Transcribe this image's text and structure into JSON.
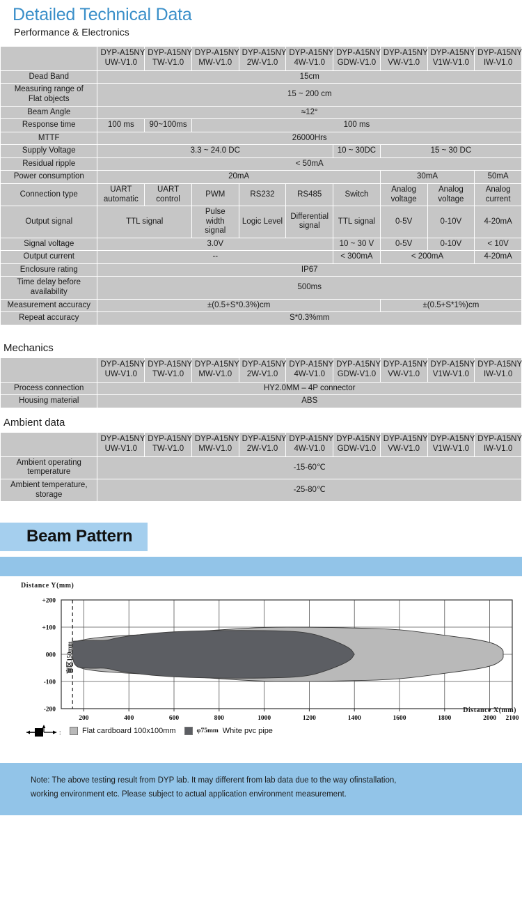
{
  "header": {
    "title": "Detailed Technical Data",
    "subtitle": "Performance & Electronics"
  },
  "colors": {
    "title_blue": "#3a8fc9",
    "header_blue": "#93c5e8",
    "banner_blue": "#92c4e8",
    "row_label_gray": "#a8a8a8",
    "cell_gray": "#c6c6c6",
    "beam_pipe_dark": "#5c5e63",
    "beam_card_light": "#b9b9b9"
  },
  "models": [
    "DYP-A15NY UW-V1.0",
    "DYP-A15NY TW-V1.0",
    "DYP-A15NY MW-V1.0",
    "DYP-A15NY 2W-V1.0",
    "DYP-A15NY 4W-V1.0",
    "DYP-A15NY GDW-V1.0",
    "DYP-A15NY VW-V1.0",
    "DYP-A15NY V1W-V1.0",
    "DYP-A15NY IW-V1.0"
  ],
  "model_lines": [
    [
      "DYP-A15NY",
      "UW-V1.0"
    ],
    [
      "DYP-A15NY",
      "TW-V1.0"
    ],
    [
      "DYP-A15NY",
      "MW-V1.0"
    ],
    [
      "DYP-A15NY",
      "2W-V1.0"
    ],
    [
      "DYP-A15NY",
      "4W-V1.0"
    ],
    [
      "DYP-A15NY",
      "GDW-V1.0"
    ],
    [
      "DYP-A15NY",
      "VW-V1.0"
    ],
    [
      "DYP-A15NY",
      "V1W-V1.0"
    ],
    [
      "DYP-A15NY",
      "IW-V1.0"
    ]
  ],
  "performance": {
    "rows": [
      {
        "label": "Dead Band",
        "cells": [
          {
            "text": "15cm",
            "span": 9
          }
        ]
      },
      {
        "label": "Measuring range of Flat objects",
        "label_lines": [
          "Measuring range of",
          "Flat objects"
        ],
        "cells": [
          {
            "text": "15 ~ 200 cm",
            "span": 9
          }
        ]
      },
      {
        "label": "Beam Angle",
        "cells": [
          {
            "text": "≈12°",
            "span": 9
          }
        ]
      },
      {
        "label": "Response time",
        "cells": [
          {
            "text": "100 ms",
            "span": 1
          },
          {
            "text": "90~100ms",
            "span": 1
          },
          {
            "text": "100 ms",
            "span": 7
          }
        ]
      },
      {
        "label": "MTTF",
        "cells": [
          {
            "text": "26000Hrs",
            "span": 9
          }
        ]
      },
      {
        "label": "Supply Voltage",
        "cells": [
          {
            "text": "3.3 ~ 24.0 DC",
            "span": 5
          },
          {
            "text": "10 ~ 30DC",
            "span": 1
          },
          {
            "text": "15 ~ 30 DC",
            "span": 3
          }
        ]
      },
      {
        "label": "Residual ripple",
        "cells": [
          {
            "text": "< 50mA",
            "span": 9
          }
        ]
      },
      {
        "label": "Power consumption",
        "cells": [
          {
            "text": "20mA",
            "span": 6
          },
          {
            "text": "30mA",
            "span": 2
          },
          {
            "text": "50mA",
            "span": 1
          }
        ]
      },
      {
        "label": "Connection type",
        "cells": [
          {
            "text": "UART automatic",
            "lines": [
              "UART",
              "automatic"
            ],
            "span": 1
          },
          {
            "text": "UART control",
            "lines": [
              "UART",
              "control"
            ],
            "span": 1
          },
          {
            "text": "PWM",
            "span": 1
          },
          {
            "text": "RS232",
            "span": 1
          },
          {
            "text": "RS485",
            "span": 1
          },
          {
            "text": "Switch",
            "span": 1
          },
          {
            "text": "Analog voltage",
            "lines": [
              "Analog",
              "voltage"
            ],
            "span": 1
          },
          {
            "text": "Analog voltage",
            "lines": [
              "Analog",
              "voltage"
            ],
            "span": 1
          },
          {
            "text": "Analog current",
            "lines": [
              "Analog",
              "current"
            ],
            "span": 1
          }
        ]
      },
      {
        "label": "Output signal",
        "cells": [
          {
            "text": "TTL signal",
            "span": 2
          },
          {
            "text": "Pulse width signal",
            "lines": [
              "Pulse width",
              "signal"
            ],
            "span": 1
          },
          {
            "text": "Logic Level",
            "span": 1
          },
          {
            "text": "Differential signal",
            "lines": [
              "Differential",
              "signal"
            ],
            "span": 1
          },
          {
            "text": "TTL signal",
            "span": 1
          },
          {
            "text": "0-5V",
            "span": 1
          },
          {
            "text": "0-10V",
            "span": 1
          },
          {
            "text": "4-20mA",
            "span": 1
          }
        ]
      },
      {
        "label": "Signal voltage",
        "cells": [
          {
            "text": "3.0V",
            "span": 5
          },
          {
            "text": "10 ~ 30 V",
            "span": 1
          },
          {
            "text": "0-5V",
            "span": 1
          },
          {
            "text": "0-10V",
            "span": 1
          },
          {
            "text": "< 10V",
            "span": 1
          }
        ]
      },
      {
        "label": "Output current",
        "cells": [
          {
            "text": "--",
            "span": 5
          },
          {
            "text": "< 300mA",
            "span": 1
          },
          {
            "text": "< 200mA",
            "span": 2
          },
          {
            "text": "4-20mA",
            "span": 1
          }
        ]
      },
      {
        "label": "Enclosure rating",
        "cells": [
          {
            "text": "IP67",
            "span": 9
          }
        ]
      },
      {
        "label": "Time delay before availability",
        "label_lines": [
          "Time delay before",
          "availability"
        ],
        "cells": [
          {
            "text": "500ms",
            "span": 9
          }
        ]
      },
      {
        "label": "Measurement accuracy",
        "cells": [
          {
            "text": "±(0.5+S*0.3%)cm",
            "span": 6
          },
          {
            "text": "±(0.5+S*1%)cm",
            "span": 3
          }
        ]
      },
      {
        "label": "Repeat accuracy",
        "cells": [
          {
            "text": "S*0.3%mm",
            "span": 9
          }
        ]
      }
    ]
  },
  "mechanics": {
    "title": "Mechanics",
    "rows": [
      {
        "label": "Process connection",
        "cells": [
          {
            "text": "HY2.0MM – 4P connector",
            "span": 9
          }
        ]
      },
      {
        "label": "Housing material",
        "cells": [
          {
            "text": "ABS",
            "span": 9
          }
        ]
      }
    ]
  },
  "ambient": {
    "title": "Ambient data",
    "rows": [
      {
        "label": "Ambient operating temperature",
        "label_lines": [
          "Ambient operating",
          "temperature"
        ],
        "cells": [
          {
            "text": "-15-60℃",
            "span": 9
          }
        ]
      },
      {
        "label": "Ambient temperature, storage",
        "label_lines": [
          "Ambient temperature,",
          "storage"
        ],
        "cells": [
          {
            "text": "-25-80℃",
            "span": 9
          }
        ]
      }
    ]
  },
  "beam": {
    "heading": "Beam Pattern",
    "note": "Note: The above testing result from DYP lab.  It may different from lab data due to the way ofinstallation, working environment etc. Please subject to actual application environment measurement.",
    "note_lines": [
      "Note: The above testing result from DYP lab.  It may different from lab data due to the way ofinstallation,",
      "working environment etc. Please subject to actual application environment measurement."
    ],
    "blind_zone_label": "盲区150mm",
    "legend": [
      {
        "swatch": "card",
        "label": "Flat cardboard 100x100mm",
        "phi": ""
      },
      {
        "swatch": "pipe",
        "label": "White pvc pipe",
        "phi": "φ75mm"
      }
    ]
  },
  "chart_data": {
    "type": "area",
    "title": "Beam Pattern",
    "xlabel": "Distance X(mm)",
    "ylabel": "Distance Y(mm)",
    "xlim": [
      100,
      2100
    ],
    "ylim": [
      -200,
      200
    ],
    "xticks": [
      200,
      400,
      600,
      800,
      1000,
      1200,
      1400,
      1600,
      1800,
      2000,
      2100
    ],
    "yticks": [
      200,
      100,
      0,
      -100,
      -200
    ],
    "ytick_labels": [
      "+200",
      "+100",
      "000",
      "-100",
      "-200"
    ],
    "grid": true,
    "legend_position": "bottom-left",
    "annotations": [
      {
        "text": "盲区150mm",
        "x": 150,
        "style": "vertical-dashed-line"
      }
    ],
    "series": [
      {
        "name": "Flat cardboard 100x100mm",
        "color": "#b9b9b9",
        "upper": [
          {
            "x": 150,
            "y": 45
          },
          {
            "x": 250,
            "y": 62
          },
          {
            "x": 400,
            "y": 70
          },
          {
            "x": 600,
            "y": 78
          },
          {
            "x": 800,
            "y": 90
          },
          {
            "x": 1000,
            "y": 100
          },
          {
            "x": 1200,
            "y": 100
          },
          {
            "x": 1400,
            "y": 97
          },
          {
            "x": 1600,
            "y": 92
          },
          {
            "x": 1800,
            "y": 70
          },
          {
            "x": 2000,
            "y": 48
          },
          {
            "x": 2060,
            "y": 20
          },
          {
            "x": 2060,
            "y": 0
          }
        ],
        "lower": [
          {
            "x": 150,
            "y": -45
          },
          {
            "x": 250,
            "y": -62
          },
          {
            "x": 400,
            "y": -70
          },
          {
            "x": 600,
            "y": -78
          },
          {
            "x": 800,
            "y": -90
          },
          {
            "x": 1000,
            "y": -100
          },
          {
            "x": 1200,
            "y": -100
          },
          {
            "x": 1400,
            "y": -97
          },
          {
            "x": 1600,
            "y": -92
          },
          {
            "x": 1800,
            "y": -70
          },
          {
            "x": 2000,
            "y": -48
          },
          {
            "x": 2060,
            "y": -20
          },
          {
            "x": 2060,
            "y": 0
          }
        ]
      },
      {
        "name": "φ75mm White pvc pipe",
        "color": "#5c5e63",
        "upper": [
          {
            "x": 150,
            "y": 48
          },
          {
            "x": 230,
            "y": 52
          },
          {
            "x": 300,
            "y": 50
          },
          {
            "x": 350,
            "y": 62
          },
          {
            "x": 500,
            "y": 78
          },
          {
            "x": 650,
            "y": 85
          },
          {
            "x": 800,
            "y": 88
          },
          {
            "x": 1000,
            "y": 88
          },
          {
            "x": 1180,
            "y": 83
          },
          {
            "x": 1280,
            "y": 60
          },
          {
            "x": 1380,
            "y": 25
          },
          {
            "x": 1400,
            "y": 0
          }
        ],
        "lower": [
          {
            "x": 150,
            "y": -48
          },
          {
            "x": 230,
            "y": -52
          },
          {
            "x": 300,
            "y": -50
          },
          {
            "x": 350,
            "y": -62
          },
          {
            "x": 500,
            "y": -78
          },
          {
            "x": 650,
            "y": -85
          },
          {
            "x": 800,
            "y": -88
          },
          {
            "x": 1000,
            "y": -88
          },
          {
            "x": 1180,
            "y": -83
          },
          {
            "x": 1280,
            "y": -60
          },
          {
            "x": 1380,
            "y": -25
          },
          {
            "x": 1400,
            "y": 0
          }
        ]
      }
    ]
  }
}
